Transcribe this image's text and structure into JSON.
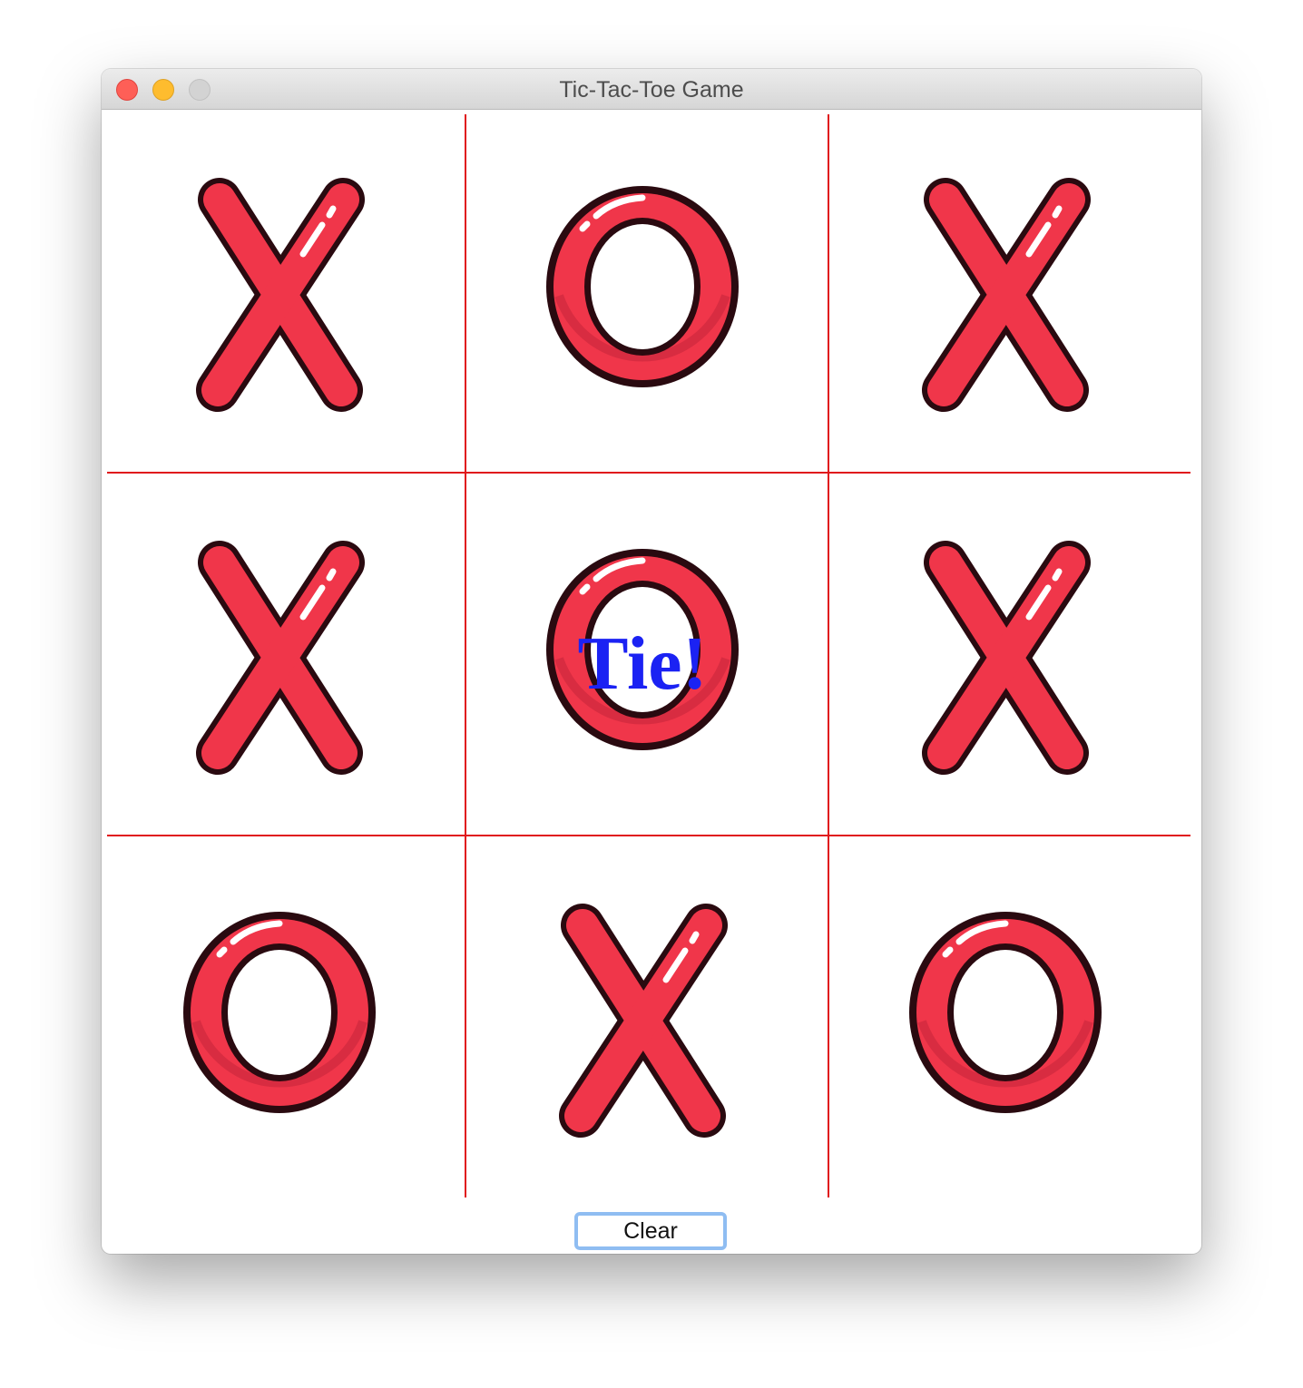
{
  "window": {
    "title": "Tic-Tac-Toe Game"
  },
  "board": {
    "cells": [
      "X",
      "O",
      "X",
      "X",
      "O",
      "X",
      "O",
      "X",
      "O"
    ],
    "grid_line_color": "#e0161b",
    "mark_fill_color": "#f0364a",
    "mark_outline_color": "#2a0a10"
  },
  "status": {
    "text": "Tie!",
    "color": "#1b22f3"
  },
  "controls": {
    "clear_label": "Clear"
  },
  "icons": {
    "x_mark": "x-mark-icon",
    "o_mark": "o-mark-icon"
  }
}
